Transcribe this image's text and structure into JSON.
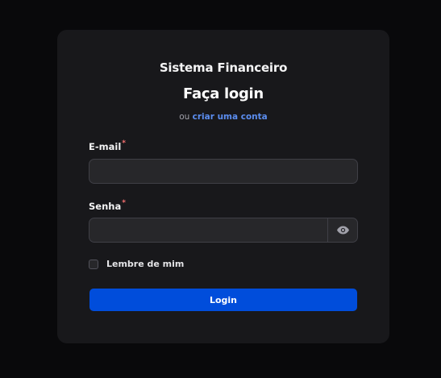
{
  "colors": {
    "background": "#09090b",
    "card": "#18181b",
    "input": "#27272a",
    "primary_button": "#004ddb",
    "link": "#5b8def",
    "required_marker": "#f87171"
  },
  "header": {
    "app_name": "Sistema Financeiro",
    "title": "Faça login",
    "subline_prefix": "ou",
    "signup_link": "criar uma conta"
  },
  "form": {
    "email": {
      "label": "E-mail",
      "required_marker": "*",
      "value": ""
    },
    "password": {
      "label": "Senha",
      "required_marker": "*",
      "value": "",
      "toggle_icon": "eye-icon"
    },
    "remember": {
      "label": "Lembre de mim",
      "checked": false
    },
    "submit_label": "Login"
  }
}
